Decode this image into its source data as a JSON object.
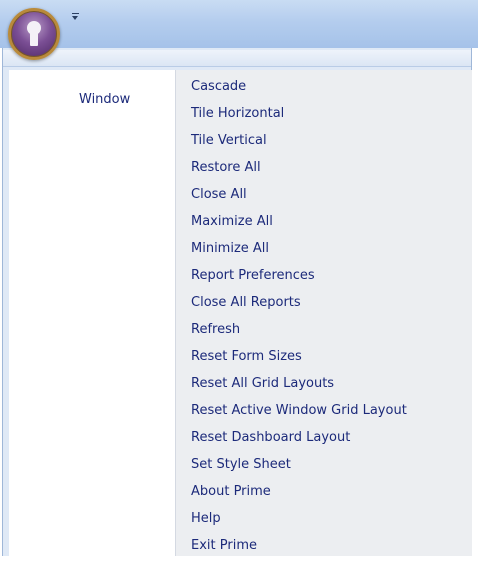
{
  "window": {
    "app_orb_icon": "keyhole-icon",
    "qat_icon": "customize-quick-access-icon"
  },
  "menu": {
    "category": "Window",
    "items": [
      "Cascade",
      "Tile Horizontal",
      "Tile Vertical",
      "Restore All",
      "Close All",
      "Maximize All",
      "Minimize All",
      "Report Preferences",
      "Close All Reports",
      "Refresh",
      "Reset Form Sizes",
      "Reset All Grid Layouts",
      "Reset Active Window Grid Layout",
      "Reset Dashboard Layout",
      "Set Style Sheet",
      "About Prime",
      "Help",
      "Exit Prime"
    ]
  },
  "colors": {
    "menu_text": "#1c2a7a",
    "titlebar": "#b4cdee",
    "menu_background": "#eceef1"
  }
}
